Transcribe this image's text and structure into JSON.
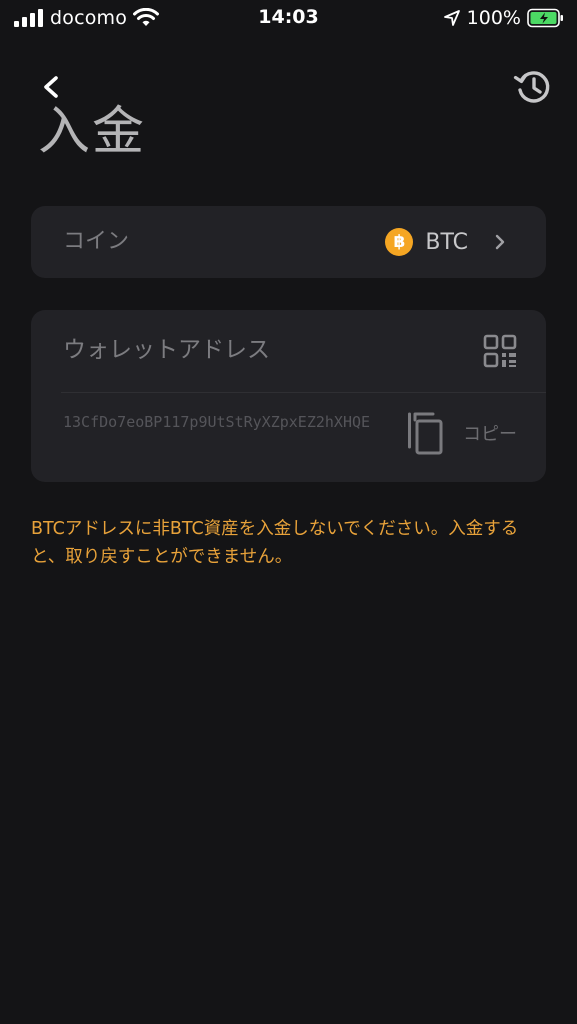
{
  "status_bar": {
    "carrier": "docomo",
    "time": "14:03",
    "battery_percent": "100%"
  },
  "header": {
    "title": "入金"
  },
  "coin_selector": {
    "label": "コイン",
    "coin": "BTC",
    "coin_icon_glyph": "฿",
    "coin_color": "#f5a623"
  },
  "address_card": {
    "label": "ウォレットアドレス",
    "address": "13CfDo7eoBP117p9UtStRyXZpxEZ2hXHQE",
    "copy_label": "コピー"
  },
  "warning": {
    "text": "BTCアドレスに非BTC資産を入金しないでください。入金すると、取り戻すことができません。",
    "color": "#e8a23a"
  },
  "icons": {
    "back": "chevron-left-icon",
    "history": "history-icon",
    "qr": "qr-code-icon",
    "copy": "copy-icon",
    "chevron": "chevron-right-icon"
  }
}
